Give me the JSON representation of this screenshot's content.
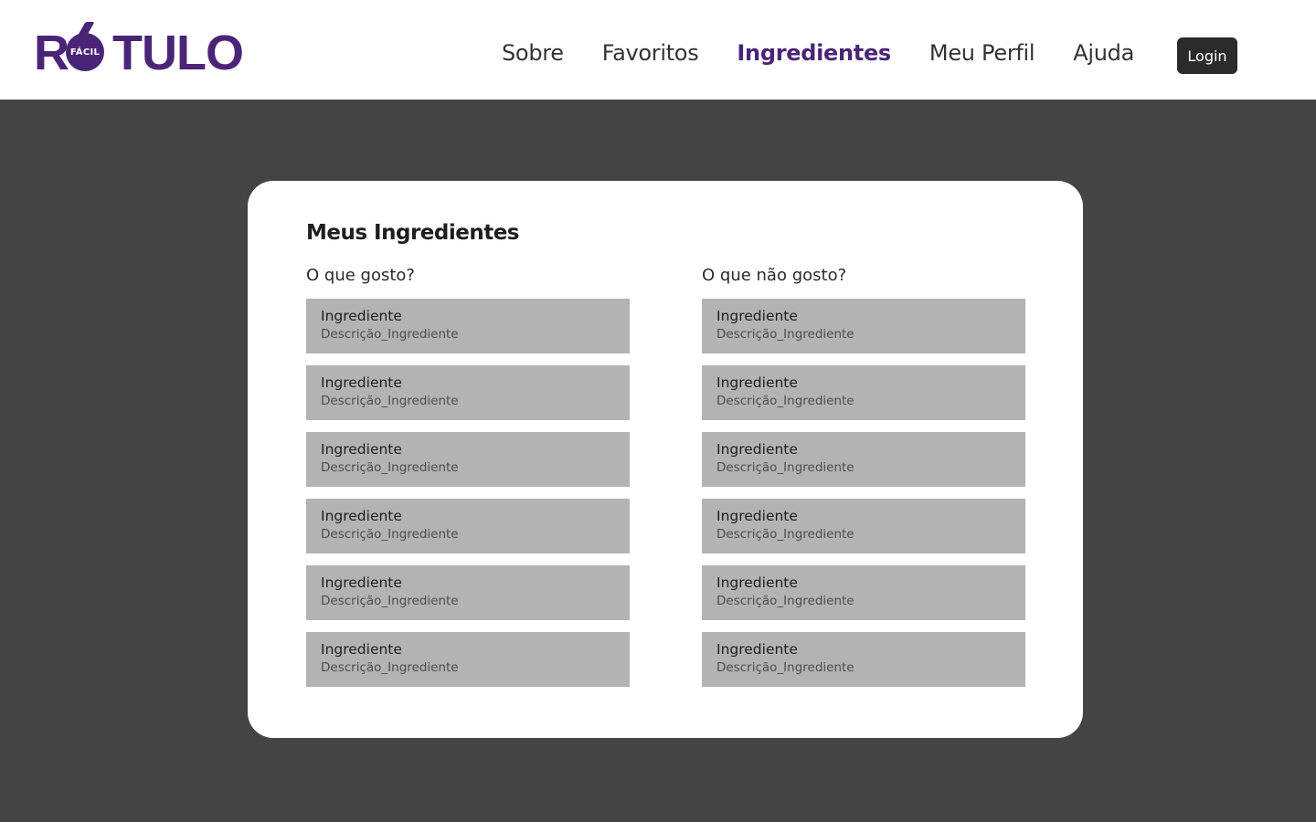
{
  "brand": {
    "name_r": "R",
    "name_rest": "TULO",
    "badge": "FÁCIL",
    "color": "#4a2577"
  },
  "nav": {
    "items": [
      {
        "label": "Sobre",
        "active": false
      },
      {
        "label": "Favoritos",
        "active": false
      },
      {
        "label": "Ingredientes",
        "active": true
      },
      {
        "label": "Meu Perfil",
        "active": false
      },
      {
        "label": "Ajuda",
        "active": false
      }
    ],
    "login_label": "Login"
  },
  "main": {
    "title": "Meus Ingredientes",
    "likes": {
      "heading": "O que gosto?",
      "items": [
        {
          "name": "Ingrediente",
          "description": "Descrição_Ingrediente"
        },
        {
          "name": "Ingrediente",
          "description": "Descrição_Ingrediente"
        },
        {
          "name": "Ingrediente",
          "description": "Descrição_Ingrediente"
        },
        {
          "name": "Ingrediente",
          "description": "Descrição_Ingrediente"
        },
        {
          "name": "Ingrediente",
          "description": "Descrição_Ingrediente"
        },
        {
          "name": "Ingrediente",
          "description": "Descrição_Ingrediente"
        }
      ]
    },
    "dislikes": {
      "heading": "O que não gosto?",
      "items": [
        {
          "name": "Ingrediente",
          "description": "Descrição_Ingrediente"
        },
        {
          "name": "Ingrediente",
          "description": "Descrição_Ingrediente"
        },
        {
          "name": "Ingrediente",
          "description": "Descrição_Ingrediente"
        },
        {
          "name": "Ingrediente",
          "description": "Descrição_Ingrediente"
        },
        {
          "name": "Ingrediente",
          "description": "Descrição_Ingrediente"
        },
        {
          "name": "Ingrediente",
          "description": "Descrição_Ingrediente"
        }
      ]
    }
  }
}
